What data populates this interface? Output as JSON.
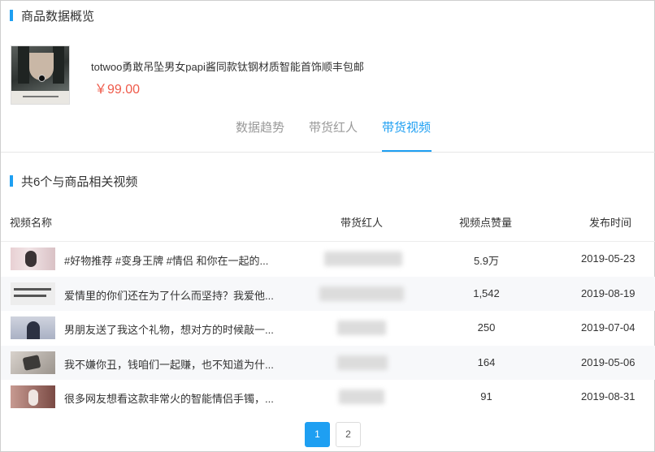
{
  "overview": {
    "title": "商品数据概览"
  },
  "product": {
    "title": "totwoo勇敢吊坠男女papi酱同款钛钢材质智能首饰顺丰包邮",
    "price": "￥99.00",
    "image_icon": "product-thumbnail"
  },
  "tabs": [
    {
      "label": "数据趋势",
      "active": false
    },
    {
      "label": "带货红人",
      "active": false
    },
    {
      "label": "带货视频",
      "active": true
    }
  ],
  "videos_section": {
    "title": "共6个与商品相关视频"
  },
  "table": {
    "headers": {
      "name": "视频名称",
      "influencer": "带货红人",
      "likes": "视频点赞量",
      "date": "发布时间"
    },
    "rows": [
      {
        "title": "#好物推荐 #变身王牌 #情侣 和你在一起的...",
        "likes": "5.9万",
        "date": "2019-05-23"
      },
      {
        "title": "爱情里的你们还在为了什么而坚持？我爱他...",
        "likes": "1,542",
        "date": "2019-08-19"
      },
      {
        "title": "男朋友送了我这个礼物，想对方的时候敲一...",
        "likes": "250",
        "date": "2019-07-04"
      },
      {
        "title": "我不嫌你丑，钱咱们一起赚，也不知道为什...",
        "likes": "164",
        "date": "2019-05-06"
      },
      {
        "title": "很多网友想看这款非常火的智能情侣手镯，...",
        "likes": "91",
        "date": "2019-08-31"
      }
    ]
  },
  "pagination": {
    "pages": [
      "1",
      "2"
    ],
    "current": "1"
  },
  "colors": {
    "accent": "#1e9ff2",
    "price": "#ef5a4a"
  }
}
